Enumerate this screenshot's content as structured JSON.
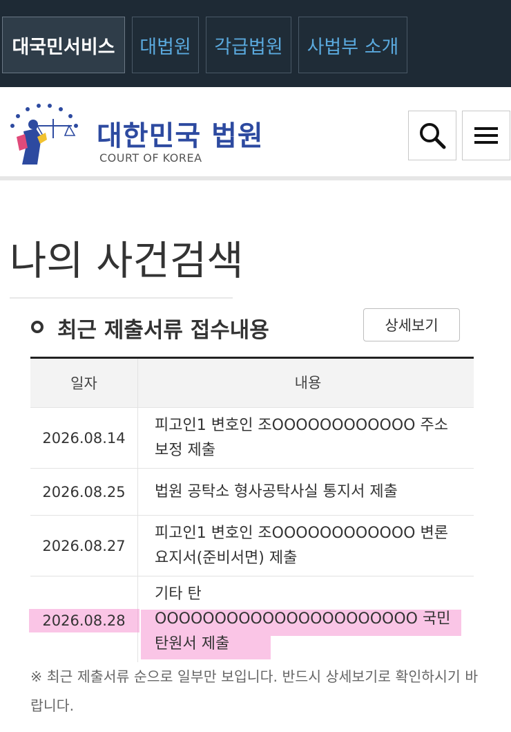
{
  "topnav": {
    "tabs": [
      {
        "label": "대국민서비스",
        "active": true
      },
      {
        "label": "대법원",
        "active": false
      },
      {
        "label": "각급법원",
        "active": false
      },
      {
        "label": "사법부 소개",
        "active": false
      }
    ]
  },
  "header": {
    "logo_title": "대한민국 법원",
    "logo_subtitle": "COURT OF KOREA",
    "emblem_text": "대한민국법원",
    "search_icon": "search-icon",
    "menu_icon": "hamburger-menu-icon"
  },
  "page": {
    "title": "나의 사건검색"
  },
  "section": {
    "title": "최근 제출서류 접수내용",
    "detail_button": "상세보기"
  },
  "table": {
    "headers": [
      "일자",
      "내용"
    ],
    "rows": [
      {
        "date": "2026.08.14",
        "content": "피고인1 변호인 조OOOOOOOOOOOO 주소보정 제출"
      },
      {
        "date": "2026.08.25",
        "content": "법원 공탁소 형사공탁사실 통지서 제출"
      },
      {
        "date": "2026.08.27",
        "content": "피고인1 변호인 조OOOOOOOOOOOO 변론요지서(준비서면) 제출"
      },
      {
        "date": "2026.08.28",
        "content": "기타 탄 OOOOOOOOOOOOOOOOOOOOOO 국민탄원서 제출"
      }
    ]
  },
  "note": "※ 최근 제출서류 순으로 일부만 보입니다. 반드시 상세보기로 확인하시기 바랍니다.",
  "colors": {
    "nav_bg": "#1e2a35",
    "nav_link": "#5aa9dd",
    "logo_blue": "#2d4aa0",
    "highlight": "#f596d2"
  }
}
